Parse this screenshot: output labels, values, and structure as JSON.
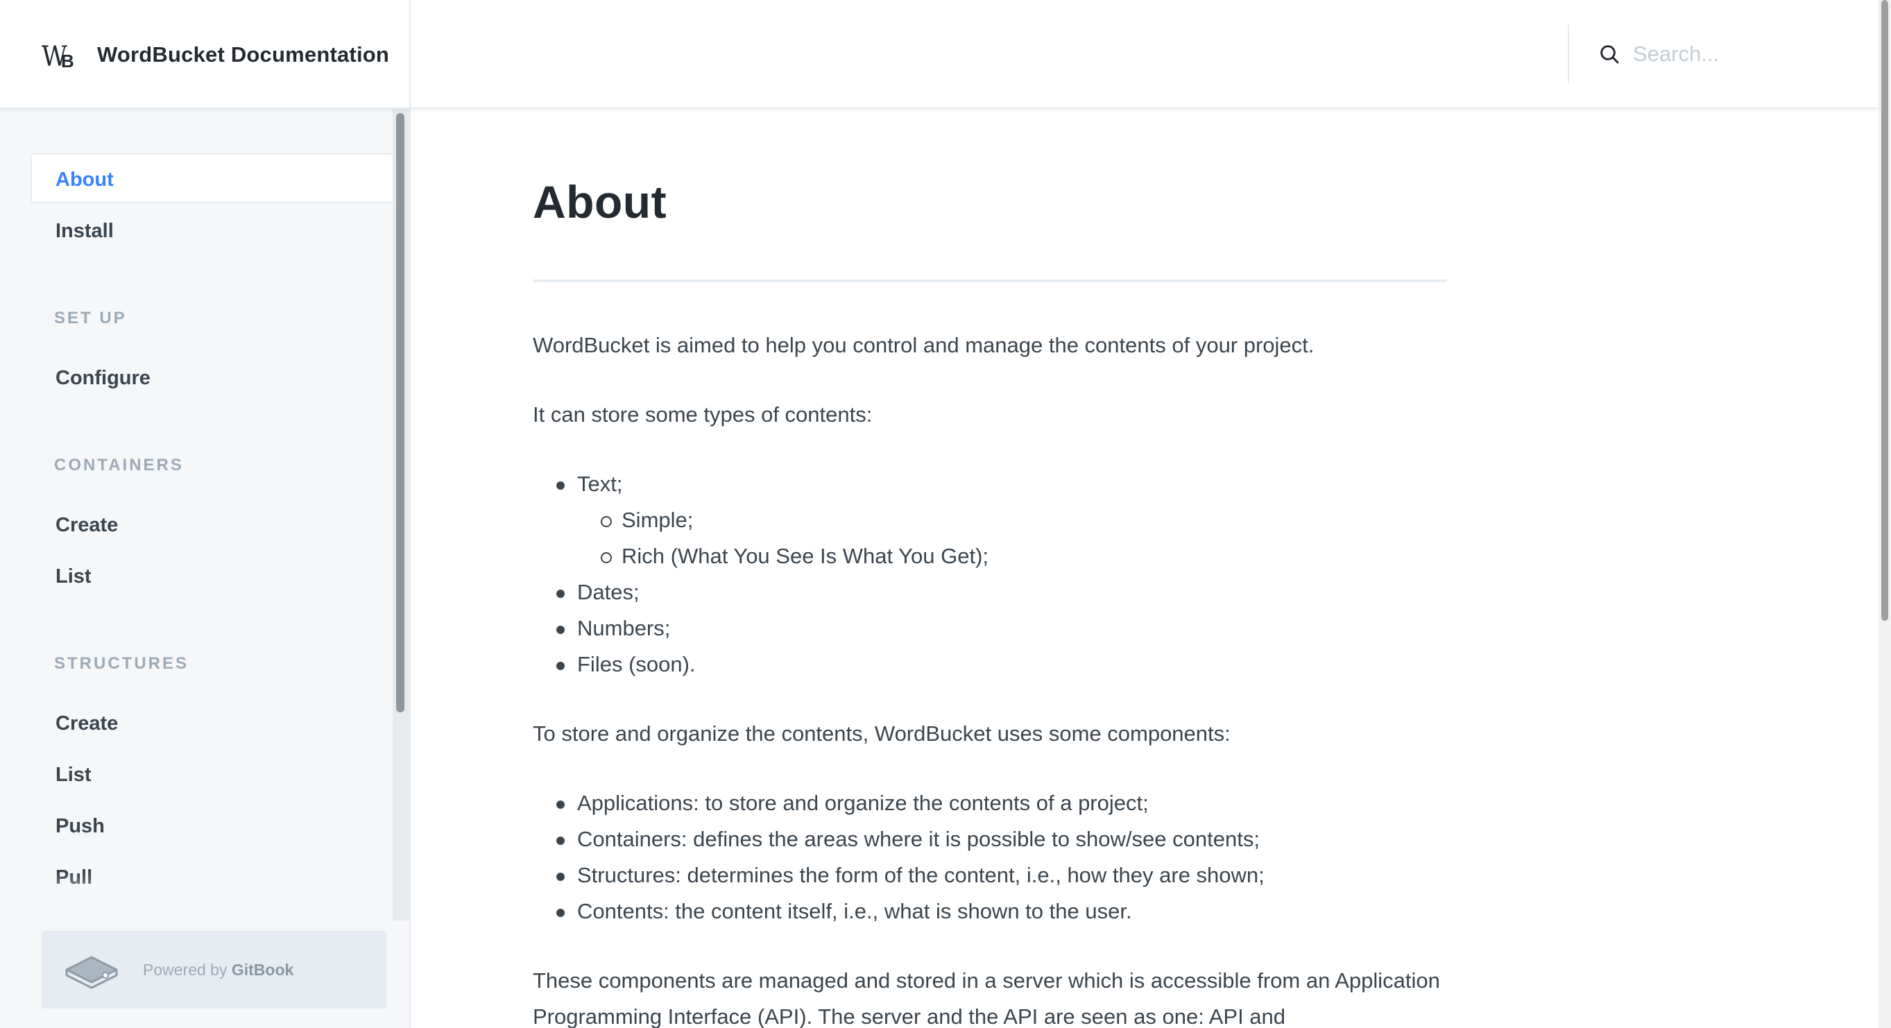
{
  "header": {
    "logo_text_w": "W",
    "logo_text_b": "B",
    "title": "WordBucket Documentation",
    "search": {
      "placeholder": "Search..."
    }
  },
  "sidebar": {
    "top_items": [
      {
        "label": "About",
        "active": true
      },
      {
        "label": "Install",
        "active": false
      }
    ],
    "sections": [
      {
        "title": "SET UP",
        "items": [
          "Configure"
        ]
      },
      {
        "title": "CONTAINERS",
        "items": [
          "Create",
          "List"
        ]
      },
      {
        "title": "STRUCTURES",
        "items": [
          "Create",
          "List",
          "Push",
          "Pull"
        ]
      }
    ],
    "powered_prefix": "Powered by",
    "powered_brand": "GitBook"
  },
  "page": {
    "title": "About",
    "para1": "WordBucket is aimed to help you control and manage the contents of your project.",
    "para2": "It can store some types of contents:",
    "types": [
      {
        "label": "Text;",
        "children": [
          "Simple;",
          "Rich (What You See Is What You Get);"
        ]
      },
      {
        "label": "Dates;"
      },
      {
        "label": "Numbers;"
      },
      {
        "label": "Files (soon)."
      }
    ],
    "para3": "To store and organize the contents, WordBucket uses some components:",
    "components": [
      "Applications: to store and organize the contents of a project;",
      "Containers: defines the areas where it is possible to show/see contents;",
      "Structures: determines the form of the content, i.e., how they are shown;",
      "Contents: the content itself, i.e., what is shown to the user."
    ],
    "para4": "These components are managed and stored in a server which is accessible from an Application Programming Interface (API). The server and the API are seen as one: API and"
  },
  "colors": {
    "accent": "#3884ff",
    "text": "#3b454e",
    "heading": "#242a31",
    "sidebar_bg": "#f5f7f9",
    "border": "#e6ecf1",
    "muted": "#9daab6"
  },
  "icons": {
    "logo": "wordbucket-logo",
    "search": "search-icon",
    "gitbook": "gitbook-icon"
  }
}
